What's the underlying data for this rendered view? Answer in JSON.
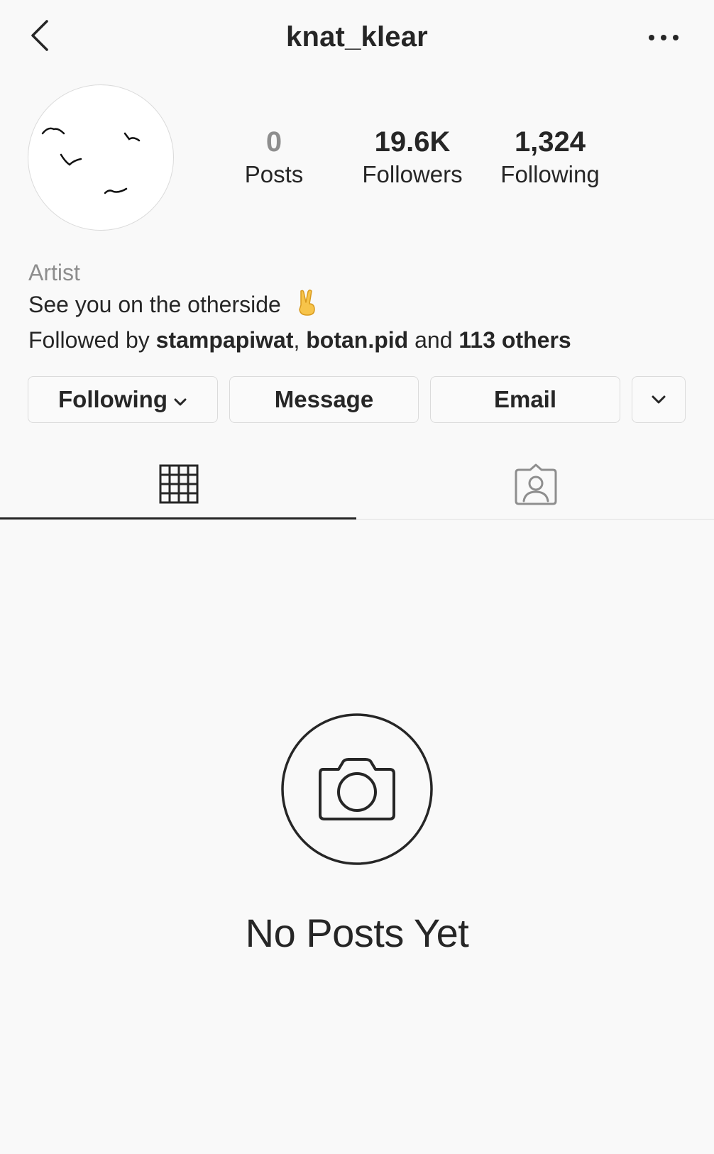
{
  "header": {
    "username": "knat_klear",
    "back_icon": "chevron-left-icon",
    "more_icon": "more-horizontal-icon"
  },
  "stats": {
    "posts": {
      "value": "0",
      "label": "Posts"
    },
    "followers": {
      "value": "19.6K",
      "label": "Followers"
    },
    "following": {
      "value": "1,324",
      "label": "Following"
    }
  },
  "bio": {
    "category": "Artist",
    "text": "See you on the otherside",
    "emoji": "victory-hand-emoji",
    "followed_by_prefix": "Followed by",
    "followed_by_user1": "stampapiwat",
    "followed_by_sep": ",",
    "followed_by_user2": "botan.pid",
    "followed_by_and": "and",
    "followed_by_others": "113 others"
  },
  "actions": {
    "following_label": "Following",
    "message_label": "Message",
    "email_label": "Email"
  },
  "tabs": {
    "grid_icon": "grid-icon",
    "tagged_icon": "tagged-person-icon",
    "active": "grid"
  },
  "empty_state": {
    "icon": "camera-icon",
    "text": "No Posts Yet"
  },
  "colors": {
    "background": "#f9f9f9",
    "text": "#262626",
    "muted": "#8e8e8e",
    "border": "#dbdbdb"
  }
}
